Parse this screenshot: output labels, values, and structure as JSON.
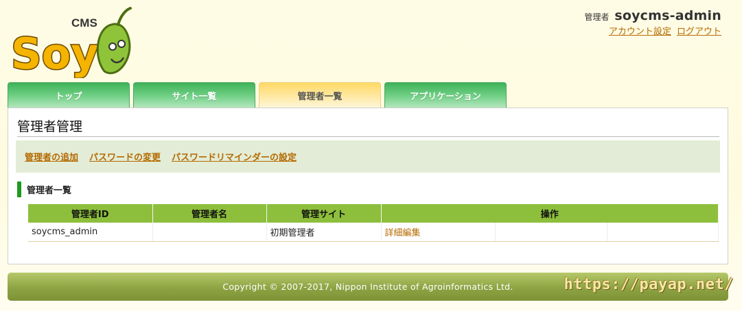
{
  "logo": {
    "badge_text": "CMS",
    "brand_text": "Soy",
    "brand_color": "#f5b400",
    "leaf_color": "#7db52f"
  },
  "header": {
    "admin_prefix": "管理者",
    "username": "soycms-admin",
    "links": {
      "account_settings": "アカウント設定",
      "logout": "ログアウト"
    },
    "link_color": "#b46a00"
  },
  "tabs": [
    {
      "label": "トップ",
      "active": false
    },
    {
      "label": "サイト一覧",
      "active": false
    },
    {
      "label": "管理者一覧",
      "active": true
    },
    {
      "label": "アプリケーション",
      "active": false
    }
  ],
  "main": {
    "title": "管理者管理",
    "actions": [
      "管理者の追加",
      "パスワードの変更",
      "パスワードリマインダーの設定"
    ],
    "section_title": "管理者一覧",
    "table": {
      "headers": [
        "管理者ID",
        "管理者名",
        "管理サイト",
        "操作"
      ],
      "rows": [
        {
          "id": "soycms_admin",
          "name": "",
          "site": "初期管理者",
          "operation": "詳細編集"
        }
      ]
    }
  },
  "footer": {
    "copyright": "Copyright © 2007-2017, Nippon Institute of Agroinformatics Ltd.",
    "watermark": "https://payap.net/"
  },
  "colors": {
    "tab_green": "#4cb864",
    "tab_active": "#ffdf80",
    "table_header": "#8dbf3c",
    "footer_olive": "#8ea343"
  }
}
